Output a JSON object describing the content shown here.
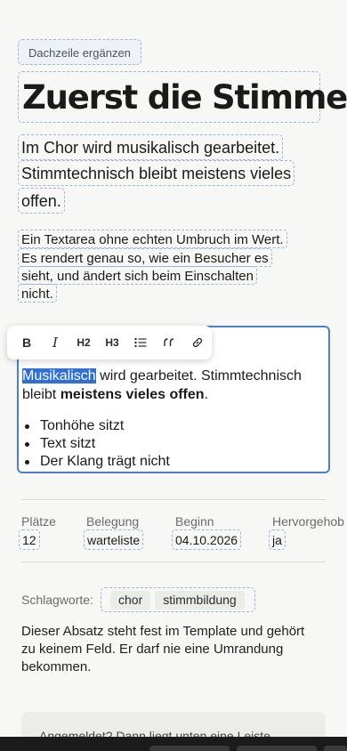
{
  "kicker": "Dachzeile ergänzen",
  "title": "Zuerst die Stimme",
  "lead_lines": [
    "Im Chor wird musikalisch gearbeitet.",
    "Stimmtechnisch bleibt meistens vieles",
    "offen."
  ],
  "textarea_lines": [
    "Ein Textarea ohne echten Umbruch im Wert.",
    "Es rendert genau so, wie ein Besucher es",
    "sieht, und ändert sich beim Einschalten",
    "nicht."
  ],
  "toolbar": {
    "bold": "B",
    "italic": "I",
    "h2": "H2",
    "h3": "H3"
  },
  "editor": {
    "selected": "Musikalisch",
    "text_after_selection": " wird gearbeitet. Stimmtechnisch bleibt ",
    "bold_text": "meistens vieles offen",
    "period": ".",
    "list_items": [
      "Tonhöhe sitzt",
      "Text sitzt",
      "Der Klang trägt nicht"
    ]
  },
  "meta": {
    "places_label": "Plätze",
    "places_value": "12",
    "booking_label": "Belegung",
    "booking_value": "warteliste",
    "start_label": "Beginn",
    "start_value": "04.10.2026",
    "featured_label": "Hervorgehob",
    "featured_value": "ja"
  },
  "tags": {
    "label": "Schlagworte:",
    "items": [
      "chor",
      "stimmbildung"
    ]
  },
  "static_text": "Dieser Absatz steht fest im Template und gehört zu keinem Feld. Er darf nie eine Umrandung bekommen.",
  "notice": "Angemeldet? Dann liegt unten eine Leiste",
  "colors": {
    "accent": "#4a7fd4",
    "selection": "#2f6fd6",
    "field_outline": "#9db5d8"
  }
}
